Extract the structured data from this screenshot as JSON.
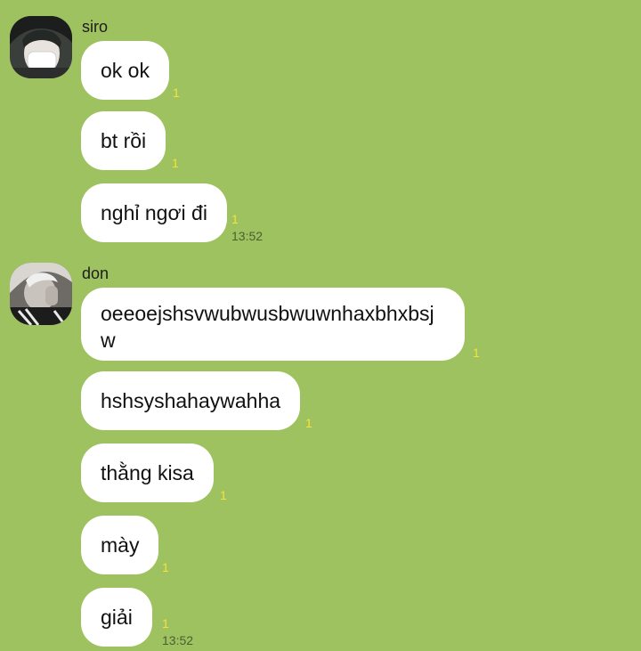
{
  "conversation": {
    "groups": [
      {
        "sender": "siro",
        "messages": [
          {
            "text": "ok ok",
            "read_count": "1"
          },
          {
            "text": "bt rồi",
            "read_count": "1"
          },
          {
            "text": "nghỉ ngơi đi",
            "read_count": "1",
            "time": "13:52"
          }
        ]
      },
      {
        "sender": "don",
        "messages": [
          {
            "text": "oeeoejshsvwubwusbwuwnhaxbhxbsjw",
            "read_count": "1"
          },
          {
            "text": "hshsyshahaywahha",
            "read_count": "1"
          },
          {
            "text": "thằng kisa",
            "read_count": "1"
          },
          {
            "text": "mày",
            "read_count": "1"
          },
          {
            "text": "giải",
            "read_count": "1",
            "time": "13:52"
          }
        ]
      }
    ]
  },
  "colors": {
    "background": "#9dc25f",
    "bubble": "#ffffff",
    "read_count": "#f7e23a",
    "timestamp": "#4d5e30"
  }
}
